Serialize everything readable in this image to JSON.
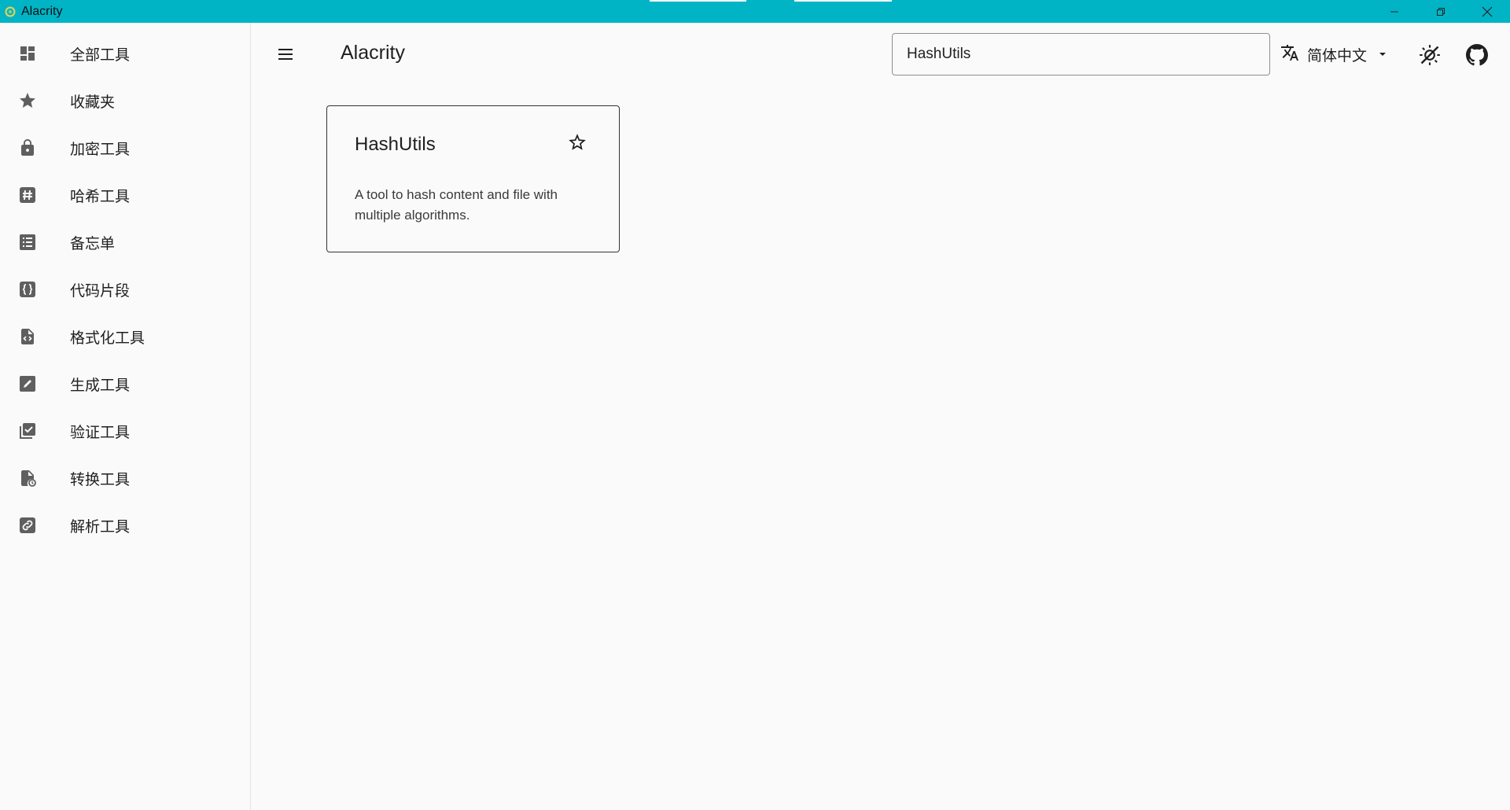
{
  "window": {
    "title": "Alacrity",
    "controls": [
      "minimize-icon",
      "restore-icon",
      "close-icon"
    ]
  },
  "sidebar": {
    "items": [
      {
        "label": "全部工具",
        "icon": "dashboard-icon"
      },
      {
        "label": "收藏夹",
        "icon": "star-icon"
      },
      {
        "label": "加密工具",
        "icon": "lock-icon"
      },
      {
        "label": "哈希工具",
        "icon": "hash-icon"
      },
      {
        "label": "备忘单",
        "icon": "list-icon"
      },
      {
        "label": "代码片段",
        "icon": "code-braces-icon"
      },
      {
        "label": "格式化工具",
        "icon": "file-code-icon"
      },
      {
        "label": "生成工具",
        "icon": "edit-box-icon"
      },
      {
        "label": "验证工具",
        "icon": "checklist-icon"
      },
      {
        "label": "转换工具",
        "icon": "file-convert-icon"
      },
      {
        "label": "解析工具",
        "icon": "link-box-icon"
      }
    ]
  },
  "header": {
    "menu_icon": "menu-icon",
    "title": "Alacrity",
    "search": {
      "value": "HashUtils",
      "placeholder": ""
    },
    "language": {
      "icon": "translate-icon",
      "selected": "简体中文"
    },
    "theme_icon": "theme-toggle-icon",
    "github_icon": "github-icon"
  },
  "cards": [
    {
      "title": "HashUtils",
      "description": "A tool to hash content and file with multiple algorithms.",
      "favorite_icon": "star-outline-icon"
    }
  ],
  "colors": {
    "titlebar": "#00b4c6",
    "background": "#fafafa",
    "icon": "#5f5f5f"
  }
}
